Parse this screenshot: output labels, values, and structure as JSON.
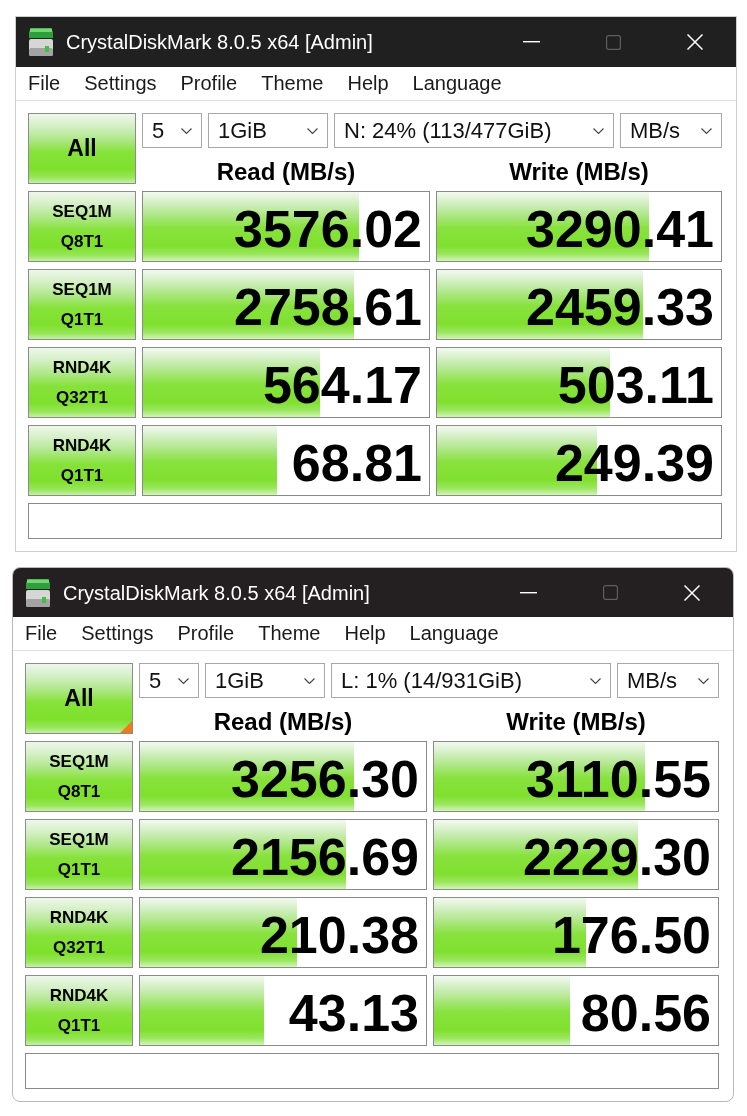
{
  "windows": [
    {
      "kind": "square",
      "title": "CrystalDiskMark 8.0.5 x64 [Admin]",
      "controls": [
        {
          "kind": "minimize",
          "disabled": false
        },
        {
          "kind": "maximize",
          "disabled": true
        },
        {
          "kind": "close",
          "disabled": false
        }
      ],
      "menu": [
        "File",
        "Settings",
        "Profile",
        "Theme",
        "Help",
        "Language"
      ],
      "all_button": {
        "label": "All",
        "marked": false
      },
      "selectors": [
        "5",
        "1GiB",
        "N: 24% (113/477GiB)",
        "MB/s"
      ],
      "headers": [
        "Read (MB/s)",
        "Write (MB/s)"
      ],
      "tests": [
        {
          "name": "SEQ1M",
          "params": "Q8T1",
          "read": {
            "value": "3576.02",
            "level": 0.756
          },
          "write": {
            "value": "3290.41",
            "level": 0.747
          }
        },
        {
          "name": "SEQ1M",
          "params": "Q1T1",
          "read": {
            "value": "2758.61",
            "level": 0.739
          },
          "write": {
            "value": "2459.33",
            "level": 0.726
          }
        },
        {
          "name": "RND4K",
          "params": "Q32T1",
          "read": {
            "value": "564.17",
            "level": 0.62
          },
          "write": {
            "value": "503.11",
            "level": 0.61
          }
        },
        {
          "name": "RND4K",
          "params": "Q1T1",
          "read": {
            "value": "68.81",
            "level": 0.47
          },
          "write": {
            "value": "249.39",
            "level": 0.565
          }
        }
      ]
    },
    {
      "kind": "rounded",
      "title": "CrystalDiskMark 8.0.5 x64 [Admin]",
      "controls": [
        {
          "kind": "minimize",
          "disabled": false
        },
        {
          "kind": "maximize",
          "disabled": true
        },
        {
          "kind": "close",
          "disabled": false
        }
      ],
      "menu": [
        "File",
        "Settings",
        "Profile",
        "Theme",
        "Help",
        "Language"
      ],
      "all_button": {
        "label": "All",
        "marked": true
      },
      "selectors": [
        "5",
        "1GiB",
        "L: 1% (14/931GiB)",
        "MB/s"
      ],
      "headers": [
        "Read (MB/s)",
        "Write (MB/s)"
      ],
      "tests": [
        {
          "name": "SEQ1M",
          "params": "Q8T1",
          "read": {
            "value": "3256.30",
            "level": 0.749
          },
          "write": {
            "value": "3110.55",
            "level": 0.744
          }
        },
        {
          "name": "SEQ1M",
          "params": "Q1T1",
          "read": {
            "value": "2156.69",
            "level": 0.72
          },
          "write": {
            "value": "2229.30",
            "level": 0.72
          }
        },
        {
          "name": "RND4K",
          "params": "Q32T1",
          "read": {
            "value": "210.38",
            "level": 0.55
          },
          "write": {
            "value": "176.50",
            "level": 0.534
          }
        },
        {
          "name": "RND4K",
          "params": "Q1T1",
          "read": {
            "value": "43.13",
            "level": 0.435
          },
          "write": {
            "value": "80.56",
            "level": 0.48
          }
        }
      ]
    }
  ]
}
